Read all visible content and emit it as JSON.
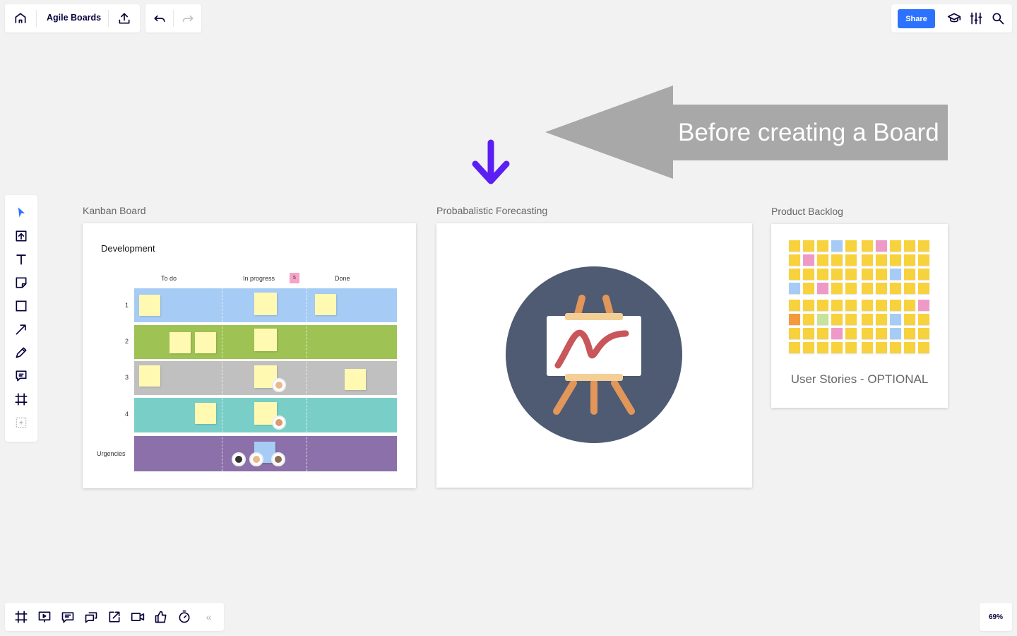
{
  "toolbar": {
    "board_name": "Agile Boards",
    "home_icon": "home-icon",
    "export_icon": "upload-icon",
    "undo_icon": "undo-icon",
    "redo_icon": "redo-icon"
  },
  "top_right": {
    "share_label": "Share",
    "learn_icon": "graduation-cap-icon",
    "settings_icon": "sliders-icon",
    "search_icon": "search-icon"
  },
  "canvas": {
    "banner_text": "Before creating a Board",
    "banner_color": "#a8a8a8",
    "down_arrow_color": "#5b1ff3",
    "frames": {
      "kanban": {
        "label": "Kanban Board",
        "heading": "Development",
        "columns": [
          "To do",
          "In progress",
          "Done"
        ],
        "wip_limit": "5",
        "lanes": [
          {
            "label": "1",
            "color": "#a6ccf5"
          },
          {
            "label": "2",
            "color": "#9ec253"
          },
          {
            "label": "3",
            "color": "#c0c0c0"
          },
          {
            "label": "4",
            "color": "#79cfc8"
          },
          {
            "label": "Urgencies",
            "color": "#8b70aa"
          }
        ]
      },
      "forecast": {
        "label": "Probabalistic Forecasting",
        "icon": "easel-chart-icon",
        "circle_color": "#4e5b73"
      },
      "backlog": {
        "label": "Product Backlog",
        "caption": "User Stories - OPTIONAL"
      }
    }
  },
  "left_toolbar": {
    "tools": [
      "select-icon",
      "upload-icon",
      "text-icon",
      "sticky-note-icon",
      "shape-icon",
      "connector-arrow-icon",
      "pen-icon",
      "comment-icon",
      "frame-icon",
      "more-tools-icon"
    ]
  },
  "bottom_toolbar": {
    "tools": [
      "frames-icon",
      "presentation-icon",
      "comments-icon",
      "chat-icon",
      "screen-share-icon",
      "video-icon",
      "vote-icon",
      "timer-icon"
    ],
    "collapse_label": "«"
  },
  "zoom": {
    "level": "69%"
  }
}
